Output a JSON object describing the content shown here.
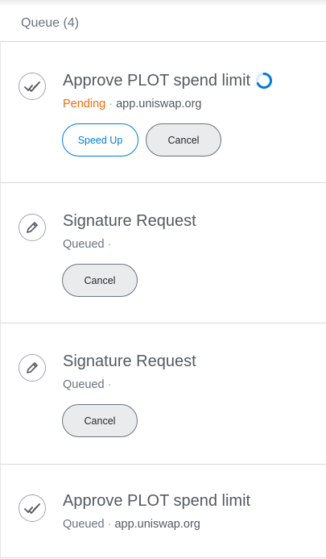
{
  "queue": {
    "header": "Queue (4)"
  },
  "transactions": [
    {
      "title": "Approve PLOT spend limit",
      "status": "Pending",
      "origin": "app.uniswap.org",
      "speed_up_label": "Speed Up",
      "cancel_label": "Cancel",
      "icon": "double-check-icon"
    },
    {
      "title": "Signature Request",
      "status": "Queued",
      "origin": "",
      "cancel_label": "Cancel",
      "icon": "pencil-icon"
    },
    {
      "title": "Signature Request",
      "status": "Queued",
      "origin": "",
      "cancel_label": "Cancel",
      "icon": "pencil-icon"
    },
    {
      "title": "Approve PLOT spend limit",
      "status": "Queued",
      "origin": "app.uniswap.org",
      "icon": "double-check-icon"
    }
  ],
  "colors": {
    "pending": "#f66a0a",
    "accent": "#037dd6",
    "queued": "#6a737d"
  }
}
